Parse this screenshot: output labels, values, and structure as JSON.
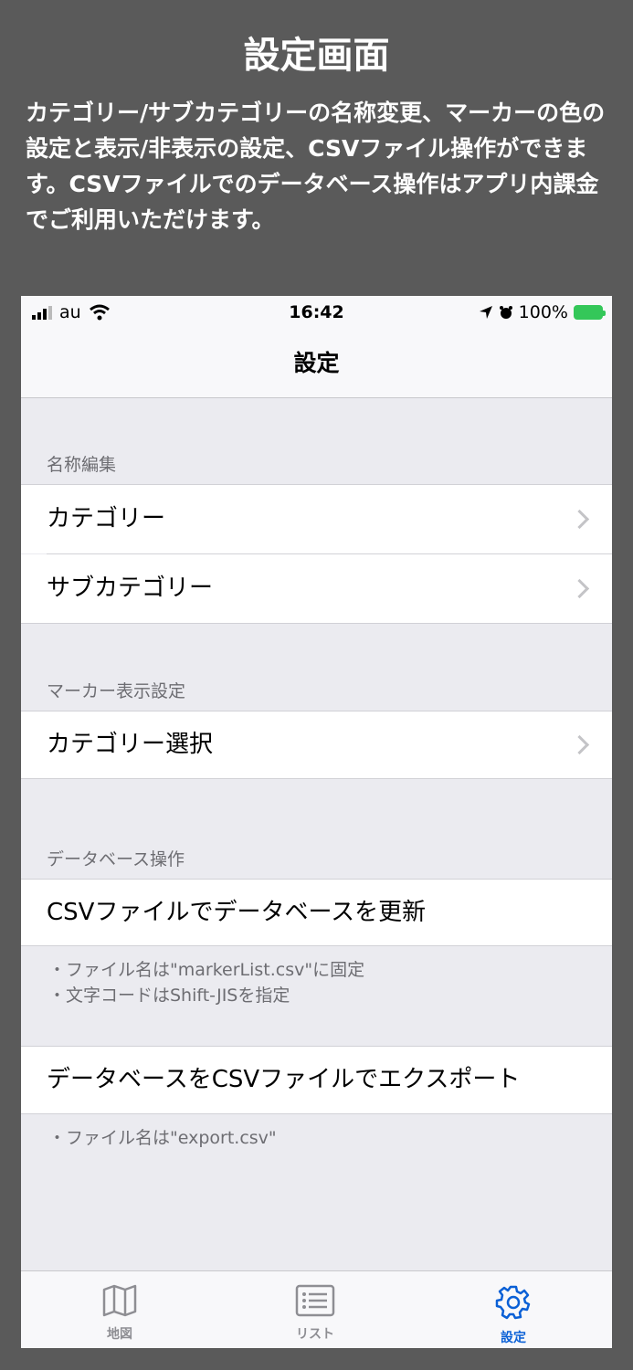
{
  "promo": {
    "title": "設定画面",
    "description": "カテゴリー/サブカテゴリーの名称変更、マーカーの色の設定と表示/非表示の設定、CSVファイル操作ができます。CSVファイルでのデータベース操作はアプリ内課金でご利用いただけます。"
  },
  "status_bar": {
    "carrier": "au",
    "time": "16:42",
    "battery": "100%"
  },
  "nav": {
    "title": "設定"
  },
  "sections": [
    {
      "header": "名称編集",
      "rows": [
        "カテゴリー",
        "サブカテゴリー"
      ]
    },
    {
      "header": "マーカー表示設定",
      "rows": [
        "カテゴリー選択"
      ]
    },
    {
      "header": "データベース操作",
      "rows": [
        "CSVファイルでデータベースを更新"
      ],
      "footer_lines": [
        "・ファイル名は\"markerList.csv\"に固定",
        "・文字コードはShift-JISを指定"
      ]
    },
    {
      "rows": [
        "データベースをCSVファイルでエクスポート"
      ],
      "footer_lines": [
        "・ファイル名は\"export.csv\""
      ]
    }
  ],
  "tabs": [
    {
      "label": "地図",
      "icon": "map-icon",
      "active": false
    },
    {
      "label": "リスト",
      "icon": "list-icon",
      "active": false
    },
    {
      "label": "設定",
      "icon": "gear-icon",
      "active": true
    }
  ],
  "colors": {
    "accent": "#0a60d6",
    "background": "#5a5a5a",
    "battery": "#34c759"
  }
}
